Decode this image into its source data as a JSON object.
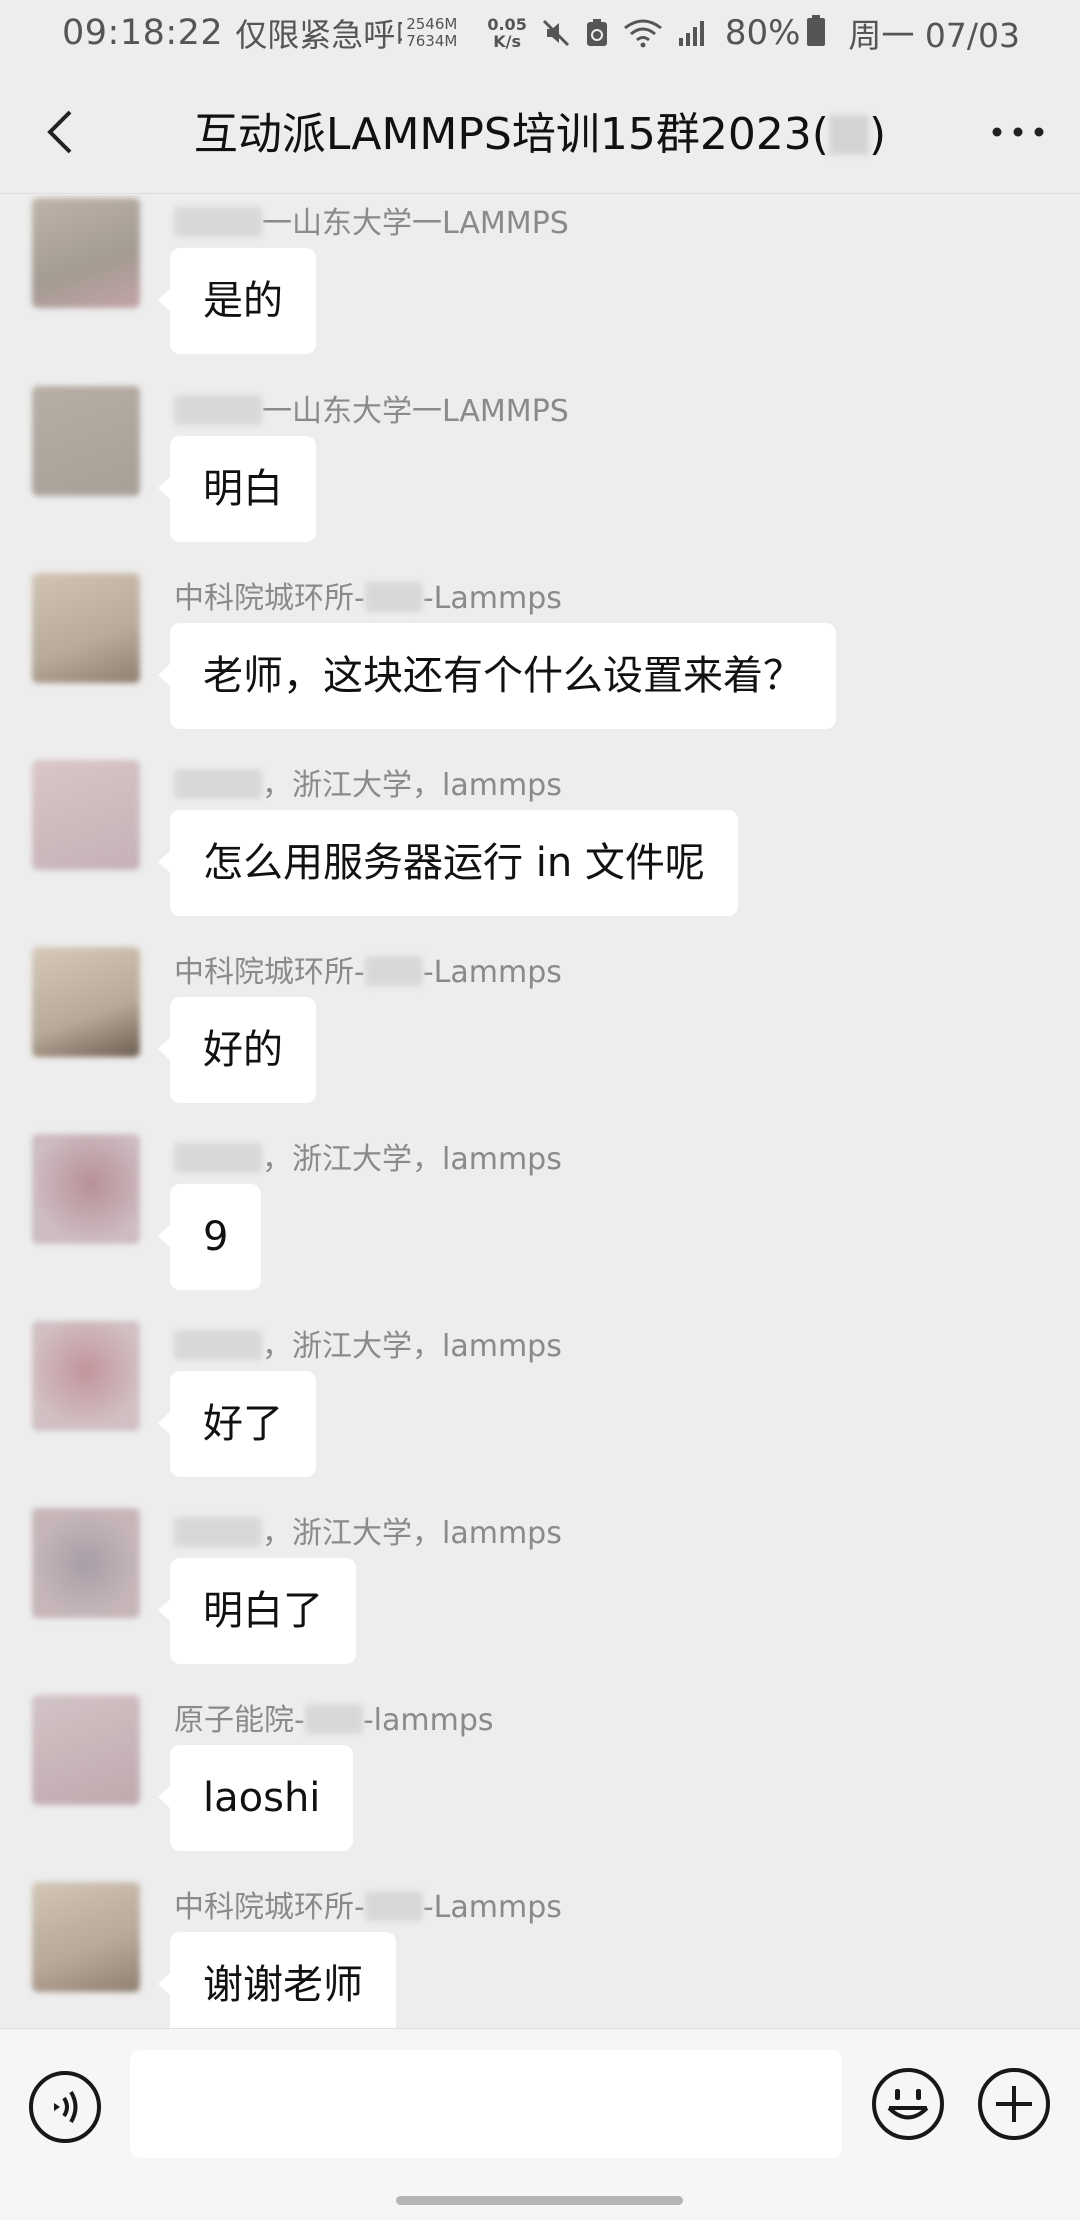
{
  "status_bar": {
    "time": "09:18:22",
    "emergency_text": "仅限紧急呼叫",
    "mem_top": "2546M",
    "mem_bottom": "7634M",
    "speed_value": "0.05",
    "speed_unit": "K/s",
    "battery": "80%",
    "date": "周一 07/03",
    "icons": [
      "mute-icon",
      "recycle-icon",
      "wifi-icon",
      "signal-icon",
      "battery-icon"
    ]
  },
  "header": {
    "title": "互动派LAMMPS培训15群2023(",
    "title_end": ")",
    "back_icon": "chevron-left-icon",
    "more_icon": "more-dots-icon"
  },
  "messages": [
    {
      "sender_suffix": "一山东大学一LAMMPS",
      "text": "是的"
    },
    {
      "sender_suffix": "一山东大学一LAMMPS",
      "text": "明白"
    },
    {
      "sender_prefix": "中科院城环所-",
      "sender_suffix": "-Lammps",
      "text": "老师，这块还有个什么设置来着？"
    },
    {
      "sender_suffix": "，浙江大学，lammps",
      "text": "怎么用服务器运行 in 文件呢"
    },
    {
      "sender_prefix": "中科院城环所-",
      "sender_suffix": "-Lammps",
      "text": "好的"
    },
    {
      "sender_suffix": "，浙江大学，lammps",
      "text": "9"
    },
    {
      "sender_suffix": "，浙江大学，lammps",
      "text": "好了"
    },
    {
      "sender_suffix": "，浙江大学，lammps",
      "text": "明白了"
    },
    {
      "sender_prefix": "原子能院-",
      "sender_suffix": "-lammps",
      "text": "laoshi"
    },
    {
      "sender_prefix": "中科院城环所-",
      "sender_suffix": "-Lammps",
      "text": "谢谢老师"
    }
  ],
  "input_bar": {
    "placeholder": "",
    "voice_icon": "voice-icon",
    "emoji_icon": "emoji-icon",
    "plus_icon": "plus-icon"
  },
  "colors": {
    "background": "#ededed",
    "bubble": "#ffffff",
    "sender_text": "#8a8a8a",
    "input_bar": "#f6f6f6"
  }
}
